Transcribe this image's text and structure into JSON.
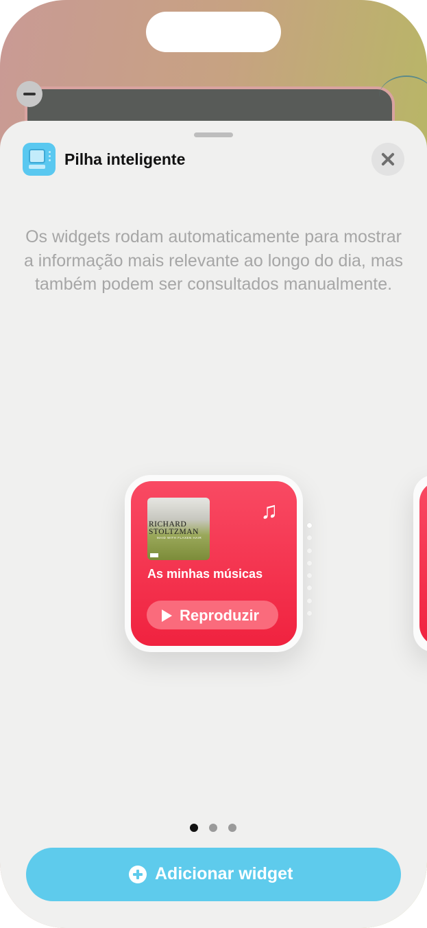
{
  "sheet": {
    "title": "Pilha inteligente",
    "description": "Os widgets rodam automaticamente para mostrar a informação mais relevante ao longo do dia, mas também podem ser consultados manualmente."
  },
  "widget": {
    "album_title": "RICHARD",
    "album_title_2": "STOLTZMAN",
    "album_subtitle": "MAID WITH FLAXEN HAIR",
    "label": "As minhas músicas",
    "play_label": "Reproduzir",
    "icon": "music-note-icon"
  },
  "stack_indicator": {
    "count": 8,
    "active_index": 0
  },
  "pager": {
    "count": 3,
    "active_index": 0
  },
  "actions": {
    "add_label": "Adicionar widget"
  },
  "colors": {
    "accent": "#5ecbec",
    "widget": "#f0223f",
    "sheet_bg": "#f0f0ef"
  }
}
